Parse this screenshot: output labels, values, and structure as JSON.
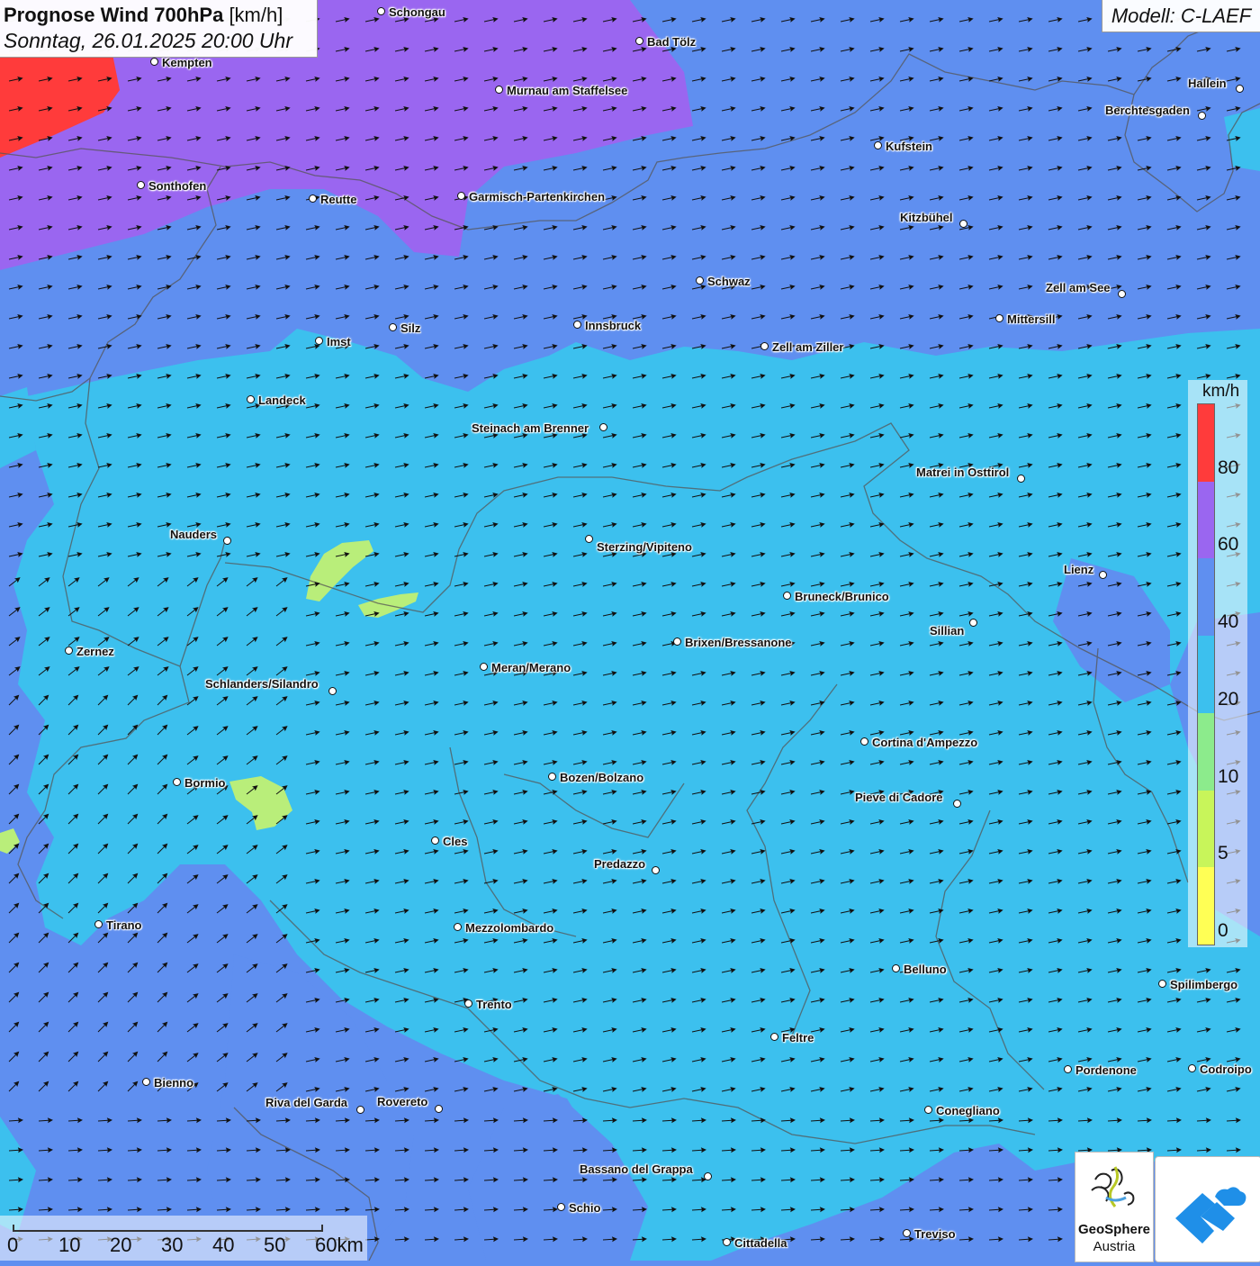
{
  "title": {
    "main_bold": "Prognose Wind 700hPa",
    "main_unit": "[km/h]",
    "datetime": "Sonntag, 26.01.2025 20:00 Uhr"
  },
  "model": "Modell: C-LAEF",
  "legend": {
    "unit": "km/h",
    "classes": [
      {
        "from": 0,
        "to": 5,
        "color": "#ffff55"
      },
      {
        "from": 5,
        "to": 10,
        "color": "#c8f55a"
      },
      {
        "from": 10,
        "to": 20,
        "color": "#8ceb8c"
      },
      {
        "from": 20,
        "to": 40,
        "color": "#3cc0ee"
      },
      {
        "from": 40,
        "to": 60,
        "color": "#5f8ff0"
      },
      {
        "from": 60,
        "to": 80,
        "color": "#9a66f0"
      },
      {
        "from": 80,
        "to": 100,
        "color": "#ff3b3b"
      }
    ],
    "tick_labels": [
      "0",
      "5",
      "10",
      "20",
      "40",
      "60",
      "80"
    ]
  },
  "scale": {
    "labels": [
      "0",
      "10",
      "20",
      "30",
      "40",
      "50",
      "60km"
    ]
  },
  "logos": {
    "geosphere_line1": "GeoSphere",
    "geosphere_line2": "Austria",
    "geosphere_icon": "geosphere-swirl-icon",
    "app_icon": "cloud-chevron-icon"
  },
  "wind": {
    "direction": "from west-southwest, slight turn to southwest in the southwest of the map",
    "prevailing_speed_class": "20–40 km/h"
  },
  "cities": [
    {
      "name": "Schongau"
    },
    {
      "name": "Bad Tölz"
    },
    {
      "name": "Kempten"
    },
    {
      "name": "Murnau am Staffelsee"
    },
    {
      "name": "Hallein"
    },
    {
      "name": "Berchtesgaden"
    },
    {
      "name": "Kufstein"
    },
    {
      "name": "Sonthofen"
    },
    {
      "name": "Reutte"
    },
    {
      "name": "Garmisch-Partenkirchen"
    },
    {
      "name": "Kitzbühel"
    },
    {
      "name": "Schwaz"
    },
    {
      "name": "Zell am See"
    },
    {
      "name": "Mittersill"
    },
    {
      "name": "Innsbruck"
    },
    {
      "name": "Silz"
    },
    {
      "name": "Imst"
    },
    {
      "name": "Zell am Ziller"
    },
    {
      "name": "Landeck"
    },
    {
      "name": "Steinach am Brenner"
    },
    {
      "name": "Matrei in Osttirol"
    },
    {
      "name": "Nauders"
    },
    {
      "name": "Sterzing/Vipiteno"
    },
    {
      "name": "Lienz"
    },
    {
      "name": "Bruneck/Brunico"
    },
    {
      "name": "Sillian"
    },
    {
      "name": "Brixen/Bressanone"
    },
    {
      "name": "Zernez"
    },
    {
      "name": "Meran/Merano"
    },
    {
      "name": "Schlanders/Silandro"
    },
    {
      "name": "Cortina d'Ampezzo"
    },
    {
      "name": "Bormio"
    },
    {
      "name": "Bozen/Bolzano"
    },
    {
      "name": "Pieve di Cadore"
    },
    {
      "name": "Cles"
    },
    {
      "name": "Predazzo"
    },
    {
      "name": "Tirano"
    },
    {
      "name": "Mezzolombardo"
    },
    {
      "name": "Belluno"
    },
    {
      "name": "Spilimbergo"
    },
    {
      "name": "Trento"
    },
    {
      "name": "Feltre"
    },
    {
      "name": "Pordenone"
    },
    {
      "name": "Codroipo"
    },
    {
      "name": "Bienno"
    },
    {
      "name": "Riva del Garda"
    },
    {
      "name": "Rovereto"
    },
    {
      "name": "Conegliano"
    },
    {
      "name": "Bassano del Grappa"
    },
    {
      "name": "Schio"
    },
    {
      "name": "Treviso"
    },
    {
      "name": "Cittadella"
    }
  ]
}
